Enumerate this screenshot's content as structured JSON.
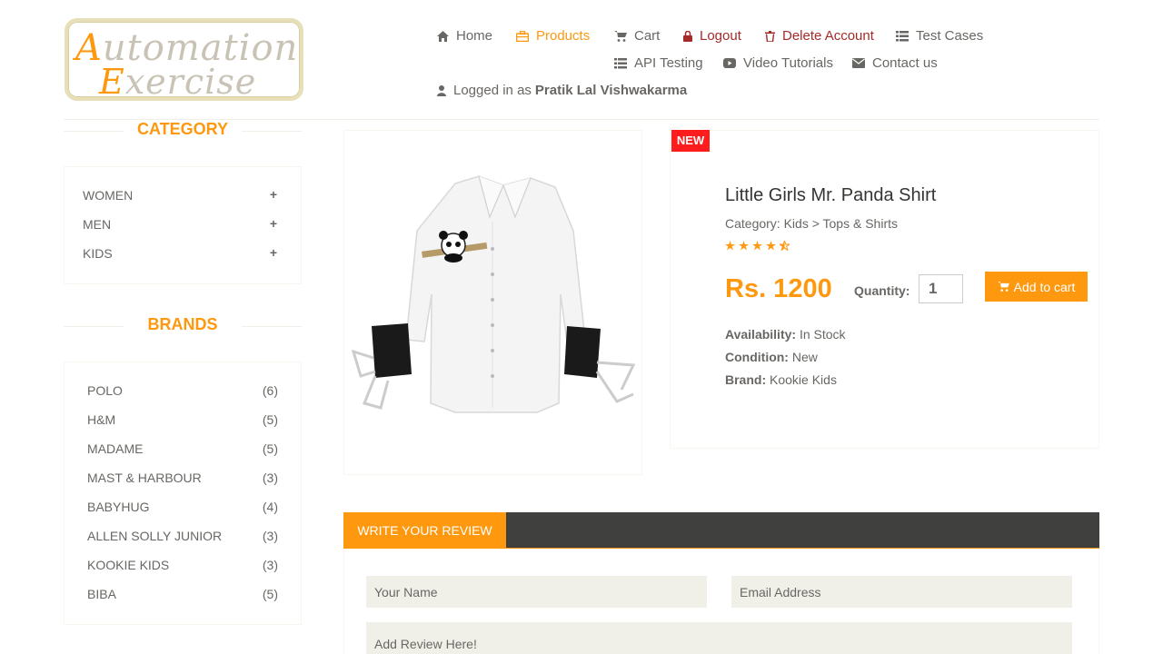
{
  "logo": {
    "line1_cap": "A",
    "line1_rest": "utomation",
    "line2_cap": "E",
    "line2_rest": "xercise"
  },
  "nav": {
    "home": "Home",
    "products": "Products",
    "cart": "Cart",
    "logout": "Logout",
    "delete_account": "Delete Account",
    "test_cases": "Test Cases",
    "api_testing": "API Testing",
    "video_tutorials": "Video Tutorials",
    "contact_us": "Contact us"
  },
  "user": {
    "prefix": "Logged in as",
    "name": "Pratik Lal Vishwakarma"
  },
  "sidebar": {
    "category_title": "CATEGORY",
    "categories": [
      {
        "label": "WOMEN",
        "icon": "plus-icon"
      },
      {
        "label": "MEN",
        "icon": "plus-icon"
      },
      {
        "label": "KIDS",
        "icon": "plus-icon"
      }
    ],
    "brands_title": "BRANDS",
    "brands": [
      {
        "name": "POLO",
        "count": "(6)"
      },
      {
        "name": "H&M",
        "count": "(5)"
      },
      {
        "name": "MADAME",
        "count": "(5)"
      },
      {
        "name": "MAST & HARBOUR",
        "count": "(3)"
      },
      {
        "name": "BABYHUG",
        "count": "(4)"
      },
      {
        "name": "ALLEN SOLLY JUNIOR",
        "count": "(3)"
      },
      {
        "name": "KOOKIE KIDS",
        "count": "(3)"
      },
      {
        "name": "BIBA",
        "count": "(5)"
      }
    ]
  },
  "product": {
    "badge": "NEW",
    "title": "Little Girls Mr. Panda Shirt",
    "category": "Category: Kids > Tops & Shirts",
    "rating": 4.5,
    "price": "Rs. 1200",
    "quantity_label": "Quantity:",
    "quantity_value": "1",
    "add_to_cart": "Add to cart",
    "availability_label": "Availability:",
    "availability": "In Stock",
    "condition_label": "Condition:",
    "condition": "New",
    "brand_label": "Brand:",
    "brand": "Kookie Kids"
  },
  "review": {
    "tab": "WRITE YOUR REVIEW",
    "name_placeholder": "Your Name",
    "email_placeholder": "Email Address",
    "review_placeholder": "Add Review Here!"
  },
  "colors": {
    "accent": "#fe980f",
    "danger": "#a52a2a",
    "badge": "#fe1c1c",
    "dark_bar": "#40403e"
  }
}
